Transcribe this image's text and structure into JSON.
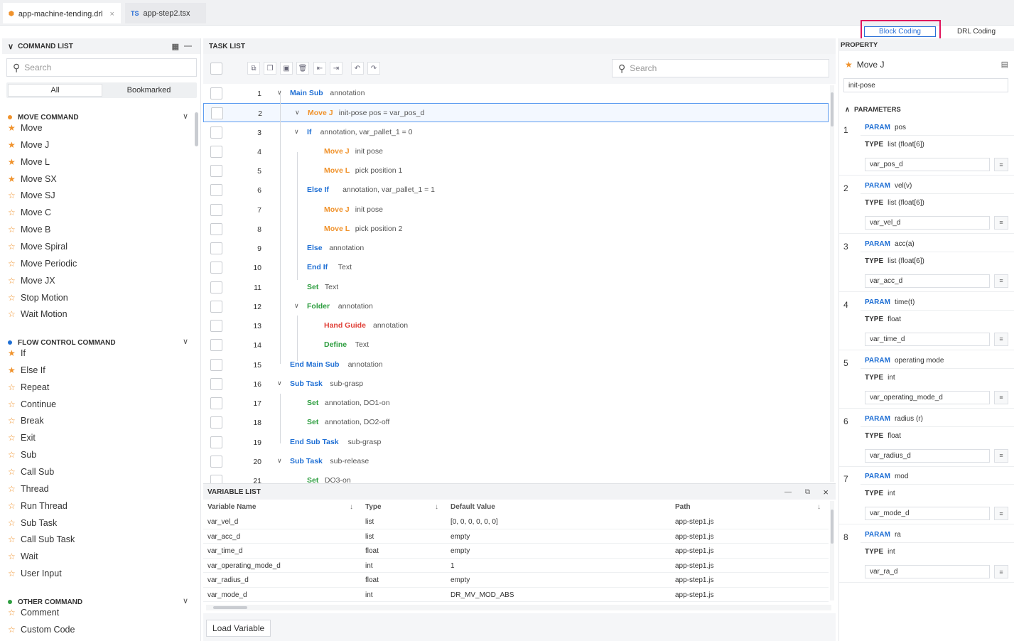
{
  "tabs": [
    {
      "icon": "⬢",
      "label": "app-machine-tending.drl",
      "close": "×"
    },
    {
      "icon": "TS",
      "label": "app-step2.tsx"
    }
  ],
  "mode": {
    "block": "Block Coding",
    "drl": "DRL Coding"
  },
  "command_list": {
    "title": "COMMAND LIST",
    "search_placeholder": "Search",
    "filters": [
      "All",
      "Bookmarked"
    ],
    "move": {
      "title": "MOVE COMMAND",
      "items": [
        "Move",
        "Move J",
        "Move L",
        "Move SX",
        "Move SJ",
        "Move C",
        "Move B",
        "Move Spiral",
        "Move Periodic",
        "Move JX",
        "Stop Motion",
        "Wait Motion"
      ],
      "starred": [
        true,
        true,
        true,
        true,
        false,
        false,
        false,
        false,
        false,
        false,
        false,
        false
      ]
    },
    "flow": {
      "title": "FLOW CONTROL COMMAND",
      "items": [
        "If",
        "Else If",
        "Repeat",
        "Continue",
        "Break",
        "Exit",
        "Sub",
        "Call Sub",
        "Thread",
        "Run Thread",
        "Sub Task",
        "Call Sub Task",
        "Wait",
        "User Input"
      ],
      "starred": [
        true,
        true,
        false,
        false,
        false,
        false,
        false,
        false,
        false,
        false,
        false,
        false,
        false,
        false
      ]
    },
    "other": {
      "title": "OTHER COMMAND",
      "items": [
        "Comment",
        "Custom Code"
      ],
      "starred": [
        false,
        false
      ]
    },
    "colors": {
      "move": "#f0922b",
      "flow": "#1f6fd4",
      "other": "#2e9e40"
    }
  },
  "task_list": {
    "title": "TASK LIST",
    "search_placeholder": "Search",
    "rows": [
      {
        "n": "1",
        "indent": 0,
        "toggle": true,
        "kw": "Main Sub",
        "color": "blue",
        "text": "annotation"
      },
      {
        "n": "2",
        "indent": 1,
        "toggle": true,
        "kw": "Move J",
        "color": "orange",
        "text": "init-pose   pos = var_pos_d",
        "selected": true
      },
      {
        "n": "3",
        "indent": 1,
        "toggle": true,
        "kw": "If",
        "color": "blue",
        "text": "annotation,   var_pallet_1 = 0"
      },
      {
        "n": "4",
        "indent": 2,
        "toggle": false,
        "kw": "Move J",
        "color": "orange",
        "text": "init pose"
      },
      {
        "n": "5",
        "indent": 2,
        "toggle": false,
        "kw": "Move L",
        "color": "orange",
        "text": "pick position 1"
      },
      {
        "n": "6",
        "indent": 1,
        "toggle": false,
        "kw": "Else If",
        "color": "blue",
        "text": "annotation,   var_pallet_1 = 1"
      },
      {
        "n": "7",
        "indent": 2,
        "toggle": false,
        "kw": "Move J",
        "color": "orange",
        "text": "init pose"
      },
      {
        "n": "8",
        "indent": 2,
        "toggle": false,
        "kw": "Move L",
        "color": "orange",
        "text": "pick position 2"
      },
      {
        "n": "9",
        "indent": 1,
        "toggle": false,
        "kw": "Else",
        "color": "blue",
        "text": "annotation"
      },
      {
        "n": "10",
        "indent": 1,
        "toggle": false,
        "kw": "End If",
        "color": "blue",
        "text": "Text"
      },
      {
        "n": "11",
        "indent": 1,
        "toggle": false,
        "kw": "Set",
        "color": "green",
        "text": "Text"
      },
      {
        "n": "12",
        "indent": 1,
        "toggle": true,
        "kw": "Folder",
        "color": "green",
        "text": "annotation"
      },
      {
        "n": "13",
        "indent": 2,
        "toggle": false,
        "kw": "Hand Guide",
        "color": "red",
        "text": "annotation"
      },
      {
        "n": "14",
        "indent": 2,
        "toggle": false,
        "kw": "Define",
        "color": "green",
        "text": "Text"
      },
      {
        "n": "15",
        "indent": 0,
        "toggle": false,
        "kw": "End Main Sub",
        "color": "blue",
        "text": "annotation"
      },
      {
        "n": "16",
        "indent": 0,
        "toggle": true,
        "kw": "Sub Task",
        "color": "blue",
        "text": "sub-grasp"
      },
      {
        "n": "17",
        "indent": 1,
        "toggle": false,
        "kw": "Set",
        "color": "green",
        "text": "annotation,   DO1-on"
      },
      {
        "n": "18",
        "indent": 1,
        "toggle": false,
        "kw": "Set",
        "color": "green",
        "text": "annotation,   DO2-off"
      },
      {
        "n": "19",
        "indent": 0,
        "toggle": false,
        "kw": "End Sub Task",
        "color": "blue",
        "text": "sub-grasp"
      },
      {
        "n": "20",
        "indent": 0,
        "toggle": true,
        "kw": "Sub Task",
        "color": "blue",
        "text": "sub-release"
      },
      {
        "n": "21",
        "indent": 1,
        "toggle": false,
        "kw": "Set",
        "color": "green",
        "text": "DO3-on"
      }
    ]
  },
  "variable_list": {
    "title": "VARIABLE LIST",
    "columns": [
      "Variable Name",
      "Type",
      "Default Value",
      "Path"
    ],
    "rows": [
      [
        "var_vel_d",
        "list",
        "[0, 0, 0, 0, 0, 0]",
        "app-step1.js"
      ],
      [
        "var_acc_d",
        "list",
        "empty",
        "app-step1.js"
      ],
      [
        "var_time_d",
        "float",
        "empty",
        "app-step1.js"
      ],
      [
        "var_operating_mode_d",
        "int",
        "1",
        "app-step1.js"
      ],
      [
        "var_radius_d",
        "float",
        "empty",
        "app-step1.js"
      ],
      [
        "var_mode_d",
        "int",
        "DR_MV_MOD_ABS",
        "app-step1.js"
      ]
    ],
    "load_button": "Load Variable"
  },
  "property": {
    "title": "PROPERTY",
    "command": "Move J",
    "name_value": "init-pose",
    "parameters_title": "PARAMETERS",
    "param_label": "PARAM",
    "type_label": "TYPE",
    "params": [
      {
        "n": "1",
        "name": "pos",
        "type": "list (float[6])",
        "value": "var_pos_d"
      },
      {
        "n": "2",
        "name": "vel(v)",
        "type": "list (float[6])",
        "value": "var_vel_d"
      },
      {
        "n": "3",
        "name": "acc(a)",
        "type": "list (float[6])",
        "value": "var_acc_d"
      },
      {
        "n": "4",
        "name": "time(t)",
        "type": "float",
        "value": "var_time_d"
      },
      {
        "n": "5",
        "name": "operating mode",
        "type": "int",
        "value": "var_operating_mode_d"
      },
      {
        "n": "6",
        "name": "radius (r)",
        "type": "float",
        "value": "var_radius_d"
      },
      {
        "n": "7",
        "name": "mod",
        "type": "int",
        "value": "var_mode_d"
      },
      {
        "n": "8",
        "name": "ra",
        "type": "int",
        "value": "var_ra_d"
      }
    ]
  }
}
